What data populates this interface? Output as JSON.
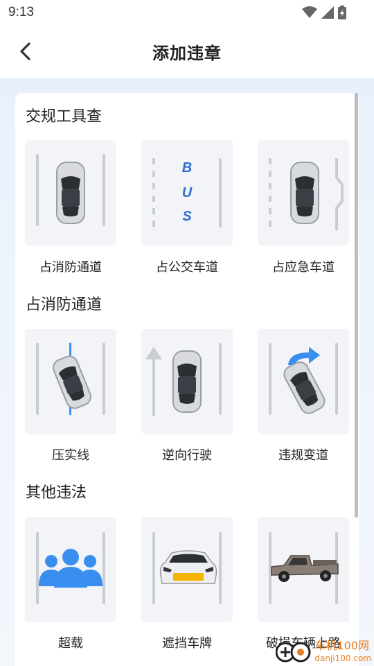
{
  "status_bar": {
    "time": "9:13",
    "icons": [
      "wifi-icon",
      "signal-icon",
      "battery-icon"
    ]
  },
  "header": {
    "title": "添加违章",
    "back_icon": "chevron-left-icon"
  },
  "sections": [
    {
      "title": "交规工具查",
      "items": [
        {
          "label": "占消防通道",
          "icon": "car-between-lanes"
        },
        {
          "label": "占公交车道",
          "icon": "bus-lane"
        },
        {
          "label": "占应急车道",
          "icon": "emergency-lane"
        }
      ]
    },
    {
      "title": "占消防通道",
      "items": [
        {
          "label": "压实线",
          "icon": "car-on-solid-line"
        },
        {
          "label": "逆向行驶",
          "icon": "wrong-way"
        },
        {
          "label": "违规变道",
          "icon": "illegal-lane-change"
        }
      ]
    },
    {
      "title": "其他违法",
      "items": [
        {
          "label": "超载",
          "icon": "people-group"
        },
        {
          "label": "遮挡车牌",
          "icon": "covered-plate"
        },
        {
          "label": "破损车辆上路",
          "icon": "damaged-truck"
        }
      ]
    }
  ],
  "bus_text": [
    "B",
    "U",
    "S"
  ],
  "watermark": {
    "brand": "车机100网",
    "domain": "danji100.com"
  },
  "colors": {
    "accent": "#3a8ef0",
    "bus_blue": "#2f6fd0",
    "tile_bg": "#f2f4f7",
    "plate": "#f5b400"
  }
}
